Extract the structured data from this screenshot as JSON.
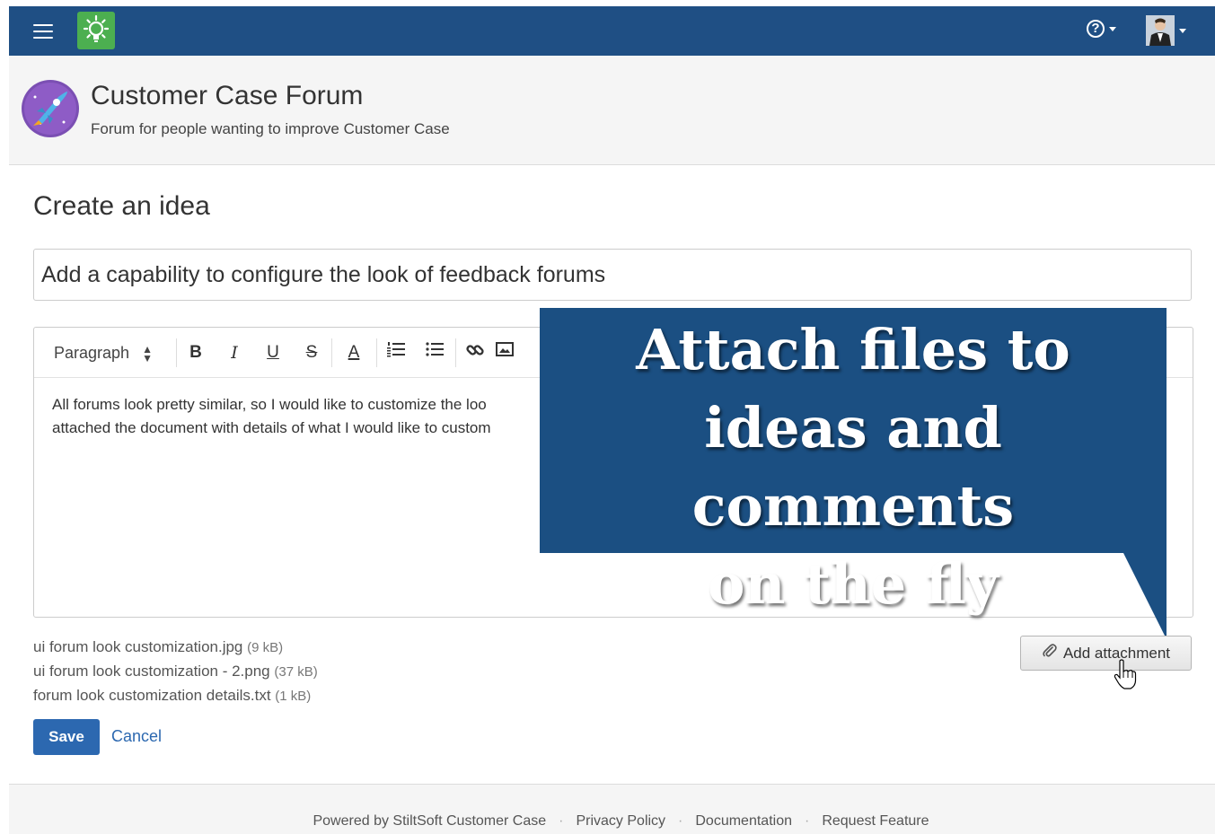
{
  "topbar": {
    "menu_icon": "hamburger-icon",
    "app_logo_icon": "lightbulb-icon",
    "help_icon": "question-circle-icon",
    "avatar_icon": "user-avatar-icon",
    "bar_color": "#1f4f84",
    "logo_color": "#4caf50"
  },
  "header": {
    "title": "Customer Case Forum",
    "subtitle": "Forum for people wanting to improve Customer Case",
    "logo_icon": "rocket-icon"
  },
  "main": {
    "page_title": "Create an idea",
    "idea_title_value": "Add a capability to configure the look of feedback forums",
    "editor": {
      "format_select": "Paragraph",
      "toolbar_icons": [
        "bold-icon",
        "italic-icon",
        "underline-icon",
        "strikethrough-icon",
        "text-color-icon",
        "ordered-list-icon",
        "bullet-list-icon",
        "link-icon",
        "image-icon"
      ],
      "bold_label": "B",
      "italic_label": "I",
      "underline_label": "U",
      "strike_label": "S",
      "color_label": "A",
      "body_line1": "All forums look pretty similar, so I would like to customize the loo",
      "body_line2": "attached the document with details of what I would like to custom"
    },
    "callout": {
      "line1": "Attach files to",
      "line2": "ideas and comments",
      "line3": "on the fly",
      "color": "#1b4f82"
    },
    "attachments": [
      {
        "name": "ui forum look customization.jpg",
        "size": "(9 kB)"
      },
      {
        "name": "ui forum look customization - 2.png",
        "size": "(37 kB)"
      },
      {
        "name": "forum look customization details.txt",
        "size": "(1 kB)"
      }
    ],
    "add_attachment_label": "Add attachment",
    "add_attachment_icon": "paperclip-icon",
    "save_label": "Save",
    "cancel_label": "Cancel",
    "accent_color": "#2c68b0"
  },
  "footer": {
    "powered_by": "Powered by StiltSoft Customer Case",
    "privacy": "Privacy Policy",
    "documentation": "Documentation",
    "request_feature": "Request Feature"
  }
}
